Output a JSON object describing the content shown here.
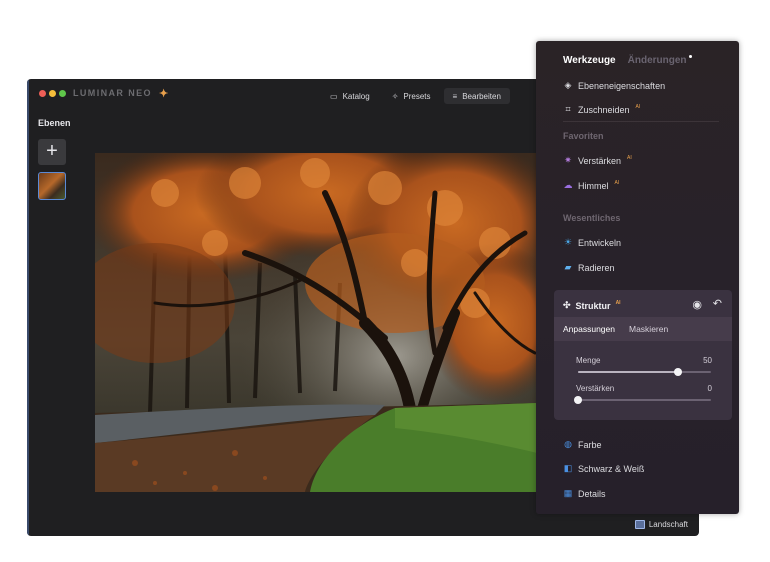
{
  "app": {
    "logo": "LUMINAR NEO",
    "tabs": [
      {
        "label": "Katalog",
        "icon": "folder-icon",
        "active": false
      },
      {
        "label": "Presets",
        "icon": "magic-wand-icon",
        "active": false
      },
      {
        "label": "Bearbeiten",
        "icon": "sliders-icon",
        "active": true
      }
    ],
    "layers_title": "Ebenen",
    "add_layer": "+",
    "status_label": "Landschaft"
  },
  "panel": {
    "tabs": [
      {
        "label": "Werkzeuge",
        "active": true
      },
      {
        "label": "Änderungen",
        "active": false
      }
    ],
    "ai_badge": "AI",
    "items_top": [
      {
        "label": "Ebeneneigenschaften",
        "icon": "layers-icon",
        "ai": false
      },
      {
        "label": "Zuschneiden",
        "icon": "crop-icon",
        "ai": true
      }
    ],
    "favorites_title": "Favoriten",
    "favorites": [
      {
        "label": "Verstärken",
        "icon": "sparkle-icon",
        "ai": true,
        "color": "#b07ad8"
      },
      {
        "label": "Himmel",
        "icon": "cloud-icon",
        "ai": true,
        "color": "#9a6fe0"
      }
    ],
    "essentials_title": "Wesentliches",
    "essentials": [
      {
        "label": "Entwickeln",
        "icon": "sun-icon",
        "color": "#4aa8e8"
      },
      {
        "label": "Radieren",
        "icon": "eraser-icon",
        "color": "#5fb0ee"
      }
    ],
    "structure": {
      "title": "Struktur",
      "subtabs": [
        {
          "label": "Anpassungen",
          "active": true
        },
        {
          "label": "Maskieren",
          "active": false
        }
      ],
      "sliders": [
        {
          "label": "Menge",
          "value": 50,
          "fraction": 0.75
        },
        {
          "label": "Verstärken",
          "value": 0,
          "fraction": 0.0
        }
      ]
    },
    "items_bottom": [
      {
        "label": "Farbe",
        "icon": "color-icon",
        "color": "#4a90e2"
      },
      {
        "label": "Schwarz & Weiß",
        "icon": "bw-icon",
        "color": "#4a90e2"
      },
      {
        "label": "Details",
        "icon": "details-icon",
        "color": "#4a90e2"
      }
    ]
  }
}
